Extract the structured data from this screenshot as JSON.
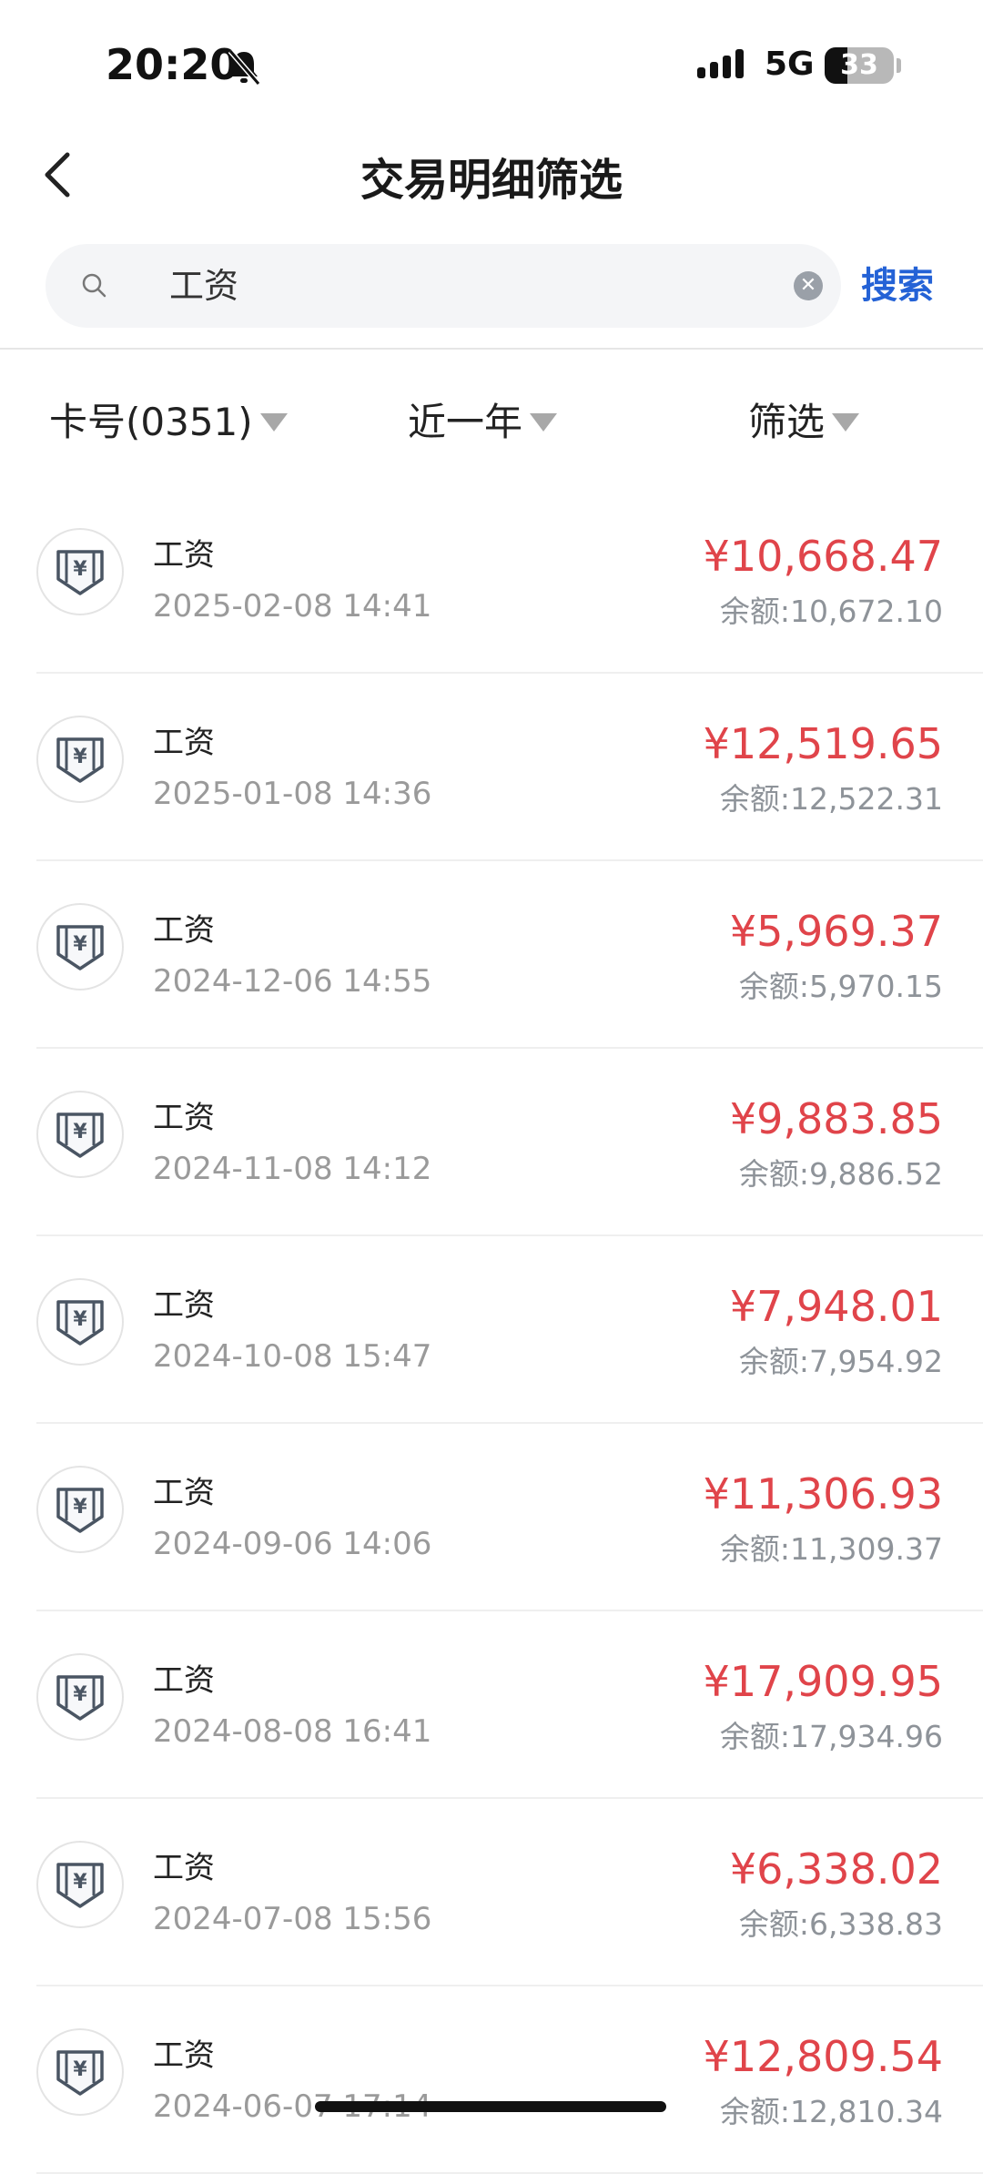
{
  "status_bar": {
    "time": "20:20",
    "network": "5G",
    "battery": "33",
    "battery_level": 0.33
  },
  "header": {
    "title": "交易明细筛选"
  },
  "search": {
    "value": "工资",
    "button_label": "搜索"
  },
  "filters": [
    {
      "label": "卡号(0351)"
    },
    {
      "label": "近一年"
    },
    {
      "label": "筛选"
    }
  ],
  "transactions": [
    {
      "name": "工资",
      "datetime": "2025-02-08 14:41",
      "amount": "¥10,668.47",
      "balance": "余额:10,672.10"
    },
    {
      "name": "工资",
      "datetime": "2025-01-08 14:36",
      "amount": "¥12,519.65",
      "balance": "余额:12,522.31"
    },
    {
      "name": "工资",
      "datetime": "2024-12-06 14:55",
      "amount": "¥5,969.37",
      "balance": "余额:5,970.15"
    },
    {
      "name": "工资",
      "datetime": "2024-11-08 14:12",
      "amount": "¥9,883.85",
      "balance": "余额:9,886.52"
    },
    {
      "name": "工资",
      "datetime": "2024-10-08 15:47",
      "amount": "¥7,948.01",
      "balance": "余额:7,954.92"
    },
    {
      "name": "工资",
      "datetime": "2024-09-06 14:06",
      "amount": "¥11,306.93",
      "balance": "余额:11,309.37"
    },
    {
      "name": "工资",
      "datetime": "2024-08-08 16:41",
      "amount": "¥17,909.95",
      "balance": "余额:17,934.96"
    },
    {
      "name": "工资",
      "datetime": "2024-07-08 15:56",
      "amount": "¥6,338.02",
      "balance": "余额:6,338.83"
    },
    {
      "name": "工资",
      "datetime": "2024-06-07 17:14",
      "amount": "¥12,809.54",
      "balance": "余额:12,810.34"
    }
  ],
  "colors": {
    "amount": "#e0444a",
    "link": "#2462d6",
    "muted": "#9a9a9a"
  },
  "icons": {
    "row_icon": "income-yuan-icon",
    "back": "chevron-left-icon",
    "search": "search-icon",
    "clear": "clear-icon",
    "mute": "bell-slash-icon"
  }
}
